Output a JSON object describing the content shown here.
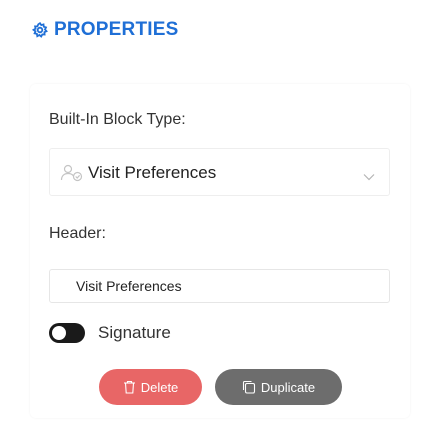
{
  "panel": {
    "title": "PROPERTIES",
    "icon": "gear-icon",
    "accent_color": "#1f6fd6"
  },
  "block_type": {
    "label": "Built-In Block Type:",
    "selected_value": "Visit Preferences",
    "icon": "users-icon"
  },
  "header": {
    "label": "Header:",
    "value": "Visit Preferences"
  },
  "signature": {
    "label": "Signature",
    "enabled": false
  },
  "actions": {
    "delete_label": "Delete",
    "delete_color": "#e86666",
    "duplicate_label": "Duplicate",
    "duplicate_color": "#6d6d6d"
  }
}
